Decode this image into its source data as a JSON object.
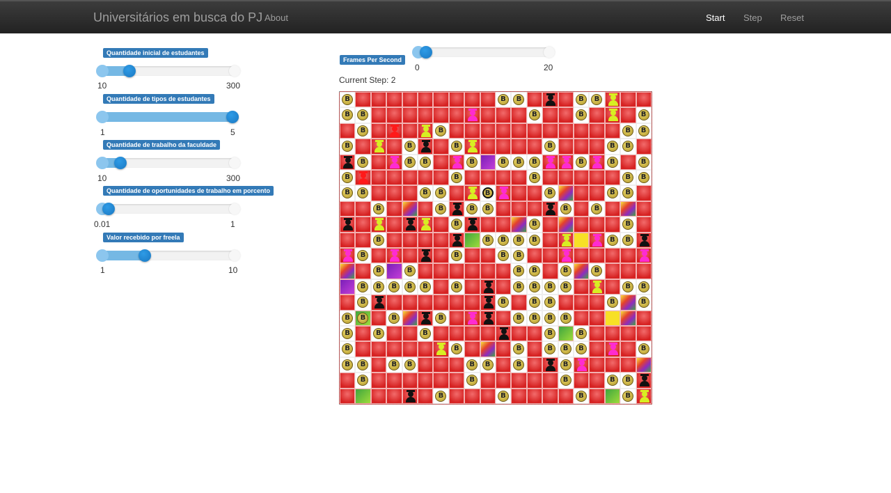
{
  "navbar": {
    "brand": "Universitários em busca do PJ",
    "about": "About",
    "start": "Start",
    "step": "Step",
    "reset": "Reset"
  },
  "sliders": [
    {
      "label": "Quantidade inicial de estudantes",
      "min": "10",
      "max": "300",
      "value_fraction": 0.2
    },
    {
      "label": "Quantidade de tipos de estudantes",
      "min": "1",
      "max": "5",
      "value_fraction": 1.0
    },
    {
      "label": "Quantidade de trabalho da faculdade",
      "min": "10",
      "max": "300",
      "value_fraction": 0.13
    },
    {
      "label": "Quantidade de oportunidades de trabalho em porcento",
      "min": "0.01",
      "max": "1",
      "value_fraction": 0.04
    },
    {
      "label": "Valor recebido por freela",
      "min": "1",
      "max": "10",
      "value_fraction": 0.32
    }
  ],
  "fps": {
    "label": "Frames Per Second",
    "min": "0",
    "max": "20",
    "value_fraction": 0.05
  },
  "status": {
    "current_step": "Current Step: 2"
  },
  "grid": {
    "size": 20,
    "coin_symbol": "B",
    "rows": [
      "C.........CC.k.CCl..R",
      "CC......m...C..C.l.C",
      ".C.R.lC...........CCCC",
      "C.l.Ck.Cl....C...CC.C",
      "kC.mCC.mCpCCCmmCmC.C",
      "CR.....C....C.....CC",
      "CC...CC.lBm..Cr..CC",
      "..C.r.CkCC...kC.C.r",
      "k.l.kl.Ck..rC.r...C",
      "..C....kgCCCC.lymCCk",
      "mC.m.k.C..CC..m....m",
      "r.CpC......CC.CrC...m",
      "pCCCCC.C.k.CCCC.l.CC",
      ".Ck......kC.CC...CrC",
      "CT.CrkC.mk.CCCC..yr",
      "C.C..C....k..CgC....",
      "C.....lC.r.C.CCC.m.C",
      "CC.CC...CC.C.kCm...r",
      ".C......C.....C..CCk",
      ".g..k.C...C....C.gClrC"
    ]
  }
}
